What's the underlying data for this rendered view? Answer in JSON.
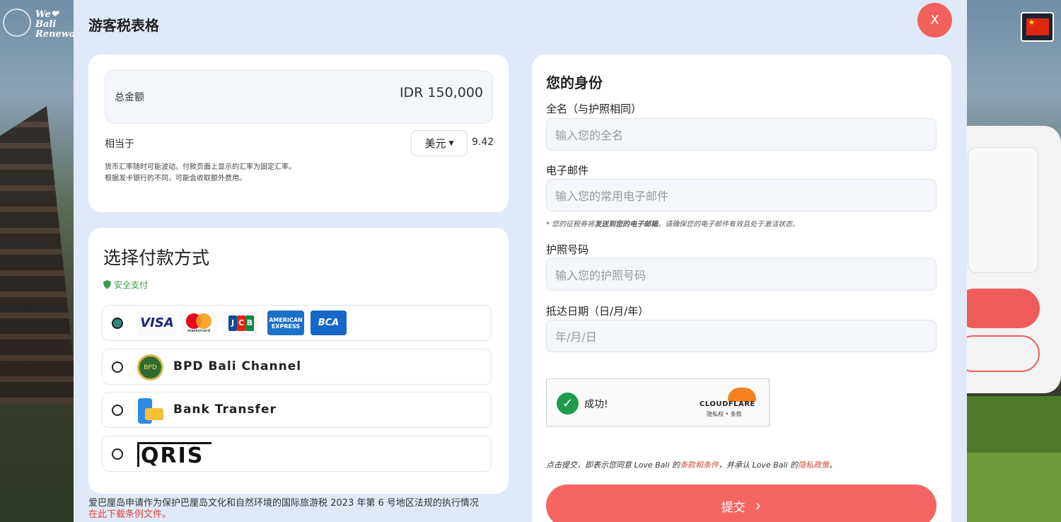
{
  "background": {
    "logo_text": "We❤\nBali\nRenewal",
    "flag_icon": "china-flag-icon"
  },
  "modal": {
    "title": "游客税表格",
    "close_label": "X"
  },
  "amount": {
    "total_label": "总金额",
    "total_value": "IDR 150,000",
    "equivalent_label": "相当于",
    "currency_selected": "美元",
    "equivalent_value": "9.42",
    "note_line1": "货币汇率随时可能波动。付款页面上显示的汇率为固定汇率。",
    "note_line2": "根据发卡银行的不同，可能会收取额外费用。"
  },
  "payment": {
    "title": "选择付款方式",
    "secure_label": "安全支付",
    "options": [
      {
        "id": "cards",
        "label": "",
        "selected": true,
        "logos": [
          "VISA",
          "mastercard",
          "JCB",
          "AMERICAN EXPRESS",
          "BCA Card"
        ]
      },
      {
        "id": "bpd",
        "label": "BPD Bali Channel",
        "selected": false
      },
      {
        "id": "bank",
        "label": "Bank Transfer",
        "selected": false
      },
      {
        "id": "qris",
        "label": "",
        "selected": false,
        "logo": "QRIS"
      }
    ]
  },
  "footer": {
    "text": "爱巴厘岛申请作为保护巴厘岛文化和自然环境的国际旅游税 2023 年第 6 号地区法规的执行情况",
    "link": "在此下载条例文件。"
  },
  "identity": {
    "title": "您的身份",
    "fullname_label": "全名（与护照相同）",
    "fullname_placeholder": "输入您的全名",
    "email_label": "电子邮件",
    "email_placeholder": "输入您的常用电子邮件",
    "email_hint_prefix": "* 您的征税券将",
    "email_hint_bold": "发送到您的电子邮箱",
    "email_hint_suffix": "。请确保您的电子邮件有效且处于激活状态。",
    "passport_label": "护照号码",
    "passport_placeholder": "输入您的护照号码",
    "arrival_label": "抵达日期（日/月/年）",
    "arrival_placeholder": "年/月/日",
    "captcha_status": "成功!",
    "captcha_brand": "CLOUDFLARE",
    "captcha_links": "隐私权 • 条款",
    "terms_prefix": "点击提交，即表示您同意 Love Bali 的",
    "terms_link1": "条款和条件",
    "terms_middle": "，并承认 Love Bali 的",
    "terms_link2": "隐私政策",
    "terms_suffix": "。",
    "submit_label": "提交"
  },
  "colors": {
    "accent": "#f56663",
    "modal_bg": "#dfe9f8",
    "secure_green": "#3a9d4a",
    "link_red": "#d9463b"
  }
}
